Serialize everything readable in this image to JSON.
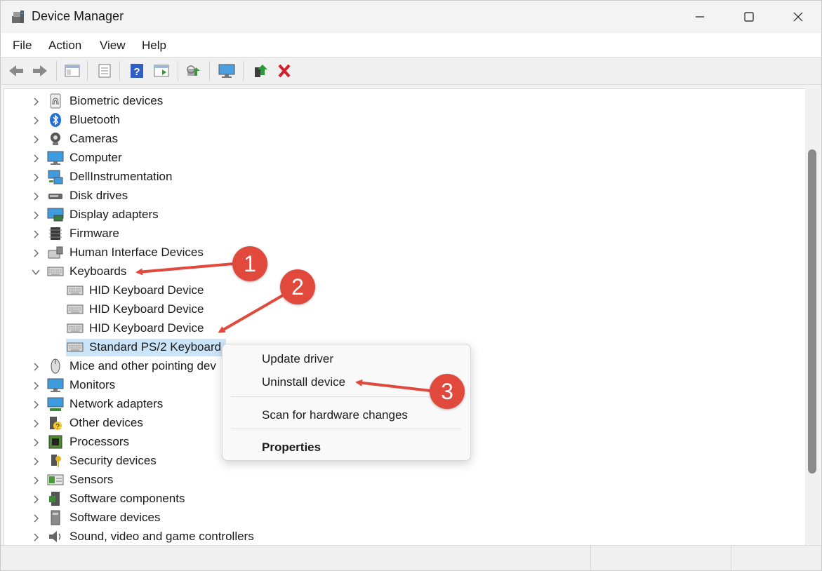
{
  "window": {
    "title": "Device Manager",
    "controls": [
      "minimize",
      "maximize",
      "close"
    ]
  },
  "menu": [
    "File",
    "Action",
    "View",
    "Help"
  ],
  "toolbar": {
    "buttons": [
      "back-icon",
      "forward-icon",
      "show-hide-console-tree-icon",
      "properties-icon",
      "help-icon",
      "action-pane-icon",
      "scan-hardware-icon",
      "monitor-icon",
      "update-driver-icon",
      "uninstall-icon"
    ]
  },
  "tree": {
    "items": [
      {
        "label": "Biometric devices",
        "expanded": false,
        "icon": "fingerprint-icon"
      },
      {
        "label": "Bluetooth",
        "expanded": false,
        "icon": "bluetooth-icon"
      },
      {
        "label": "Cameras",
        "expanded": false,
        "icon": "camera-icon"
      },
      {
        "label": "Computer",
        "expanded": false,
        "icon": "computer-icon"
      },
      {
        "label": "DellInstrumentation",
        "expanded": false,
        "icon": "network-computer-icon"
      },
      {
        "label": "Disk drives",
        "expanded": false,
        "icon": "disk-drive-icon"
      },
      {
        "label": "Display adapters",
        "expanded": false,
        "icon": "display-adapter-icon"
      },
      {
        "label": "Firmware",
        "expanded": false,
        "icon": "chip-icon"
      },
      {
        "label": "Human Interface Devices",
        "expanded": false,
        "icon": "hid-icon"
      },
      {
        "label": "Keyboards",
        "expanded": true,
        "icon": "keyboard-icon"
      },
      {
        "label": "HID Keyboard Device",
        "child": true,
        "icon": "keyboard-icon"
      },
      {
        "label": "HID Keyboard Device",
        "child": true,
        "icon": "keyboard-icon"
      },
      {
        "label": "HID Keyboard Device",
        "child": true,
        "icon": "keyboard-icon"
      },
      {
        "label": "Standard PS/2 Keyboard",
        "child": true,
        "selected": true,
        "icon": "keyboard-icon"
      },
      {
        "label": "Mice and other pointing dev",
        "expanded": false,
        "icon": "mouse-icon"
      },
      {
        "label": "Monitors",
        "expanded": false,
        "icon": "monitor-icon"
      },
      {
        "label": "Network adapters",
        "expanded": false,
        "icon": "network-adapter-icon"
      },
      {
        "label": "Other devices",
        "expanded": false,
        "icon": "unknown-device-icon"
      },
      {
        "label": "Processors",
        "expanded": false,
        "icon": "processor-icon"
      },
      {
        "label": "Security devices",
        "expanded": false,
        "icon": "security-key-icon"
      },
      {
        "label": "Sensors",
        "expanded": false,
        "icon": "sensor-icon"
      },
      {
        "label": "Software components",
        "expanded": false,
        "icon": "software-component-icon"
      },
      {
        "label": "Software devices",
        "expanded": false,
        "icon": "software-device-icon"
      },
      {
        "label": "Sound, video and game controllers",
        "expanded": false,
        "icon": "speaker-icon"
      }
    ]
  },
  "context_menu": {
    "items": [
      "Update driver",
      "Uninstall device",
      "Scan for hardware changes",
      "Properties"
    ]
  },
  "annotations": {
    "badges": [
      "1",
      "2",
      "3"
    ],
    "color": "#e2493d"
  },
  "colors": {
    "selection": "#cce4f7",
    "accent_red": "#e2493d"
  }
}
